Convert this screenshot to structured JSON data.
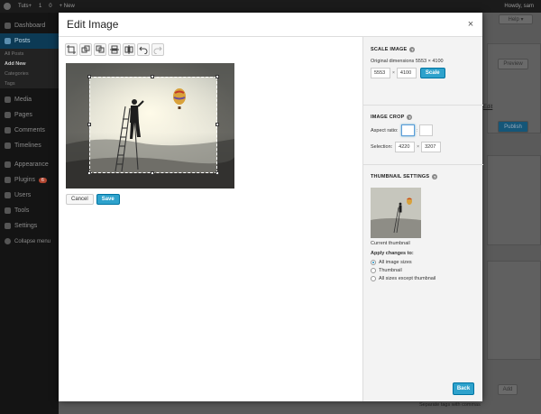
{
  "adminbar": {
    "site": "Tuts+",
    "updates": "1",
    "comments": "0",
    "new": "+ New",
    "howdy": "Howdy, sam"
  },
  "sidebar": {
    "items": [
      {
        "label": "Dashboard",
        "icon": "dashboard-icon"
      },
      {
        "label": "Posts",
        "icon": "pin-icon",
        "active": true
      },
      {
        "label": "Media",
        "icon": "media-icon"
      },
      {
        "label": "Pages",
        "icon": "pages-icon"
      },
      {
        "label": "Comments",
        "icon": "comments-icon"
      },
      {
        "label": "Timelines",
        "icon": "timelines-icon"
      },
      {
        "label": "Appearance",
        "icon": "appearance-icon"
      },
      {
        "label": "Plugins",
        "icon": "plugins-icon",
        "badge": "6"
      },
      {
        "label": "Users",
        "icon": "users-icon"
      },
      {
        "label": "Tools",
        "icon": "tools-icon"
      },
      {
        "label": "Settings",
        "icon": "settings-icon"
      },
      {
        "label": "Collapse menu",
        "icon": "collapse-icon"
      }
    ],
    "subitems": [
      "All Posts",
      "Add New",
      "Categories",
      "Tags"
    ]
  },
  "background": {
    "help": "Help ▾",
    "preview": "Preview",
    "publish": "Publish",
    "add": "Add",
    "edit_link": "Edit",
    "tags_hint": "Separate tags with commas"
  },
  "modal": {
    "title": "Edit Image",
    "close": "×",
    "toolbar": [
      "crop-icon",
      "rotate-left-box-icon",
      "rotate-right-box-icon",
      "flip-vertical-icon",
      "flip-horizontal-icon",
      "undo-icon",
      "redo-icon"
    ],
    "cancel_label": "Cancel",
    "save_label": "Save",
    "back_label": "Back"
  },
  "scale": {
    "title": "SCALE IMAGE",
    "original": "Original dimensions 5553 × 4100",
    "width": "5553",
    "height": "4100",
    "times": "×",
    "button": "Scale"
  },
  "crop": {
    "title": "IMAGE CROP",
    "aspect_label": "Aspect ratio:",
    "aspect_w": "",
    "aspect_h": "",
    "aspect_sep": ":",
    "selection_label": "Selection:",
    "sel_w": "4220",
    "sel_h": "3207",
    "times": "×"
  },
  "thumbnail": {
    "title": "THUMBNAIL SETTINGS",
    "current": "Current thumbnail",
    "apply_label": "Apply changes to:",
    "options": [
      {
        "label": "All image sizes",
        "checked": true
      },
      {
        "label": "Thumbnail",
        "checked": false
      },
      {
        "label": "All sizes except thumbnail",
        "checked": false
      }
    ]
  },
  "colors": {
    "accent": "#2ea2cc",
    "admin_dark": "#1b1b1b",
    "active_nav": "#0074a2"
  }
}
